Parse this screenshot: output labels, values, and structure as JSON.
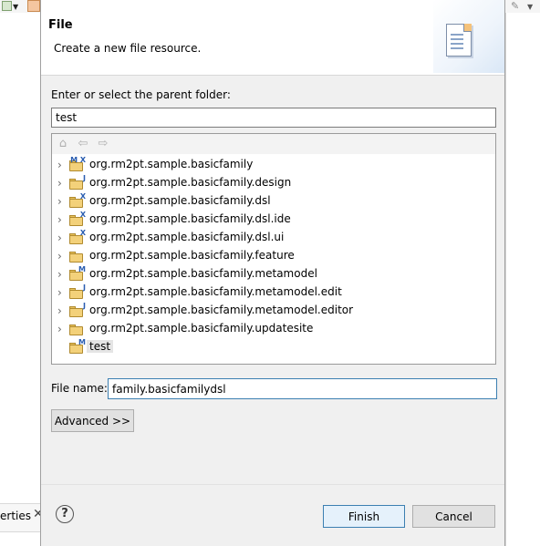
{
  "background": {
    "tab_label": "erties",
    "tab_close": "✕"
  },
  "dialog": {
    "title": "File",
    "description": "Create a new file resource.",
    "parent_label": "Enter or select the parent folder:",
    "parent_value": "test",
    "toolbar": {
      "home_icon": "⌂",
      "back_icon": "⇦",
      "forward_icon": "⇨"
    },
    "tree": [
      {
        "name": "org.rm2pt.sample.basicfamily",
        "expandable": true,
        "badge": "M X"
      },
      {
        "name": "org.rm2pt.sample.basicfamily.design",
        "expandable": true,
        "badge": "J"
      },
      {
        "name": "org.rm2pt.sample.basicfamily.dsl",
        "expandable": true,
        "badge": "X"
      },
      {
        "name": "org.rm2pt.sample.basicfamily.dsl.ide",
        "expandable": true,
        "badge": "X"
      },
      {
        "name": "org.rm2pt.sample.basicfamily.dsl.ui",
        "expandable": true,
        "badge": "X"
      },
      {
        "name": "org.rm2pt.sample.basicfamily.feature",
        "expandable": true,
        "badge": ""
      },
      {
        "name": "org.rm2pt.sample.basicfamily.metamodel",
        "expandable": true,
        "badge": "M"
      },
      {
        "name": "org.rm2pt.sample.basicfamily.metamodel.edit",
        "expandable": true,
        "badge": "J"
      },
      {
        "name": "org.rm2pt.sample.basicfamily.metamodel.editor",
        "expandable": true,
        "badge": "J"
      },
      {
        "name": "org.rm2pt.sample.basicfamily.updatesite",
        "expandable": true,
        "badge": ""
      },
      {
        "name": "test",
        "expandable": false,
        "badge": "M",
        "selected": true
      }
    ],
    "file_name_label": "File name:",
    "file_name_value": "family.basicfamilydsl",
    "advanced_label": "Advanced >>",
    "help_label": "?",
    "finish_label": "Finish",
    "cancel_label": "Cancel"
  }
}
